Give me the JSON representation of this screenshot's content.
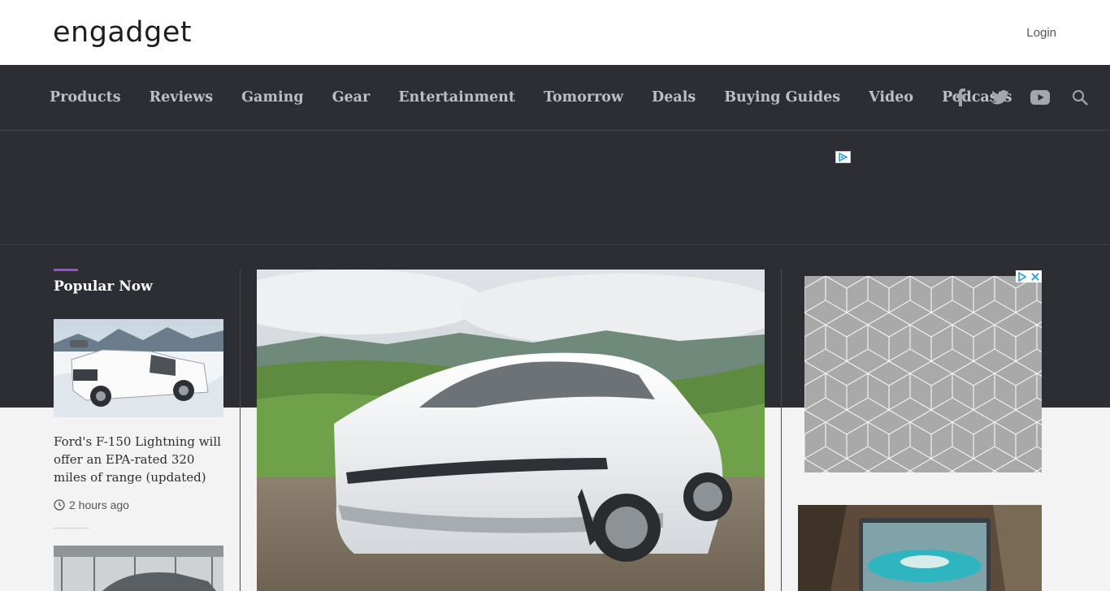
{
  "header": {
    "logo": "engadget",
    "login_label": "Login"
  },
  "nav": {
    "items": [
      {
        "label": "Products"
      },
      {
        "label": "Reviews"
      },
      {
        "label": "Gaming"
      },
      {
        "label": "Gear"
      },
      {
        "label": "Entertainment"
      },
      {
        "label": "Tomorrow"
      },
      {
        "label": "Deals"
      },
      {
        "label": "Buying Guides"
      },
      {
        "label": "Video"
      },
      {
        "label": "Podcasts"
      }
    ],
    "icons": [
      "facebook-icon",
      "twitter-icon",
      "youtube-icon",
      "search-icon"
    ]
  },
  "popular": {
    "title": "Popular Now",
    "cards": [
      {
        "title": "Ford's F-150 Lightning will offer an EPA-rated 320 miles of range (updated)",
        "time": "2 hours ago"
      }
    ]
  },
  "colors": {
    "nav_bg": "#2c2e33",
    "accent": "#9c4dd6",
    "nav_text": "#bdbfc4"
  }
}
